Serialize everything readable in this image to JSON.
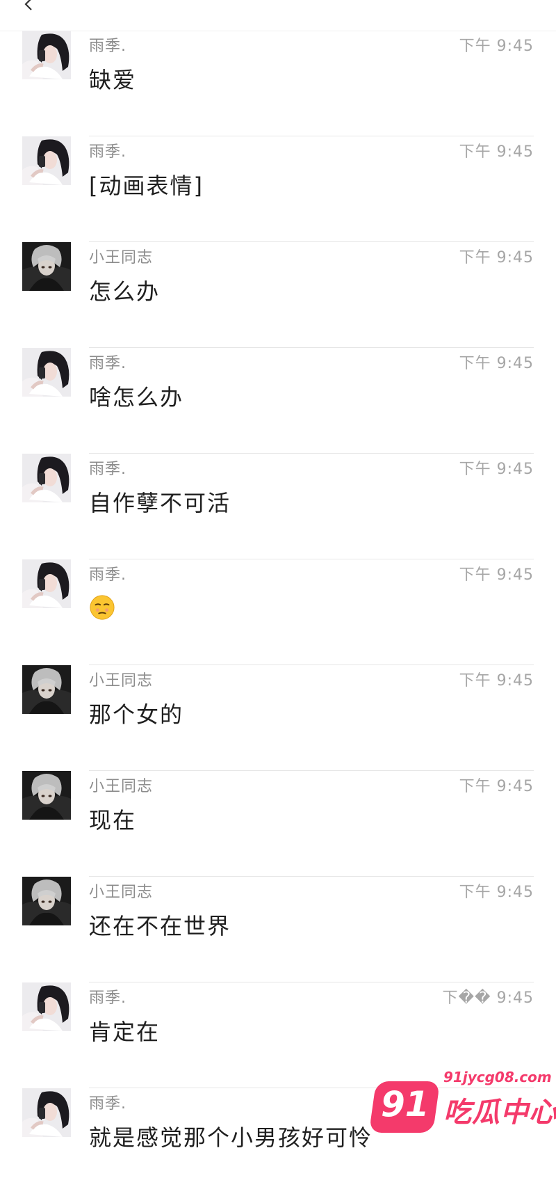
{
  "header": {
    "back_icon": "chevron-left-icon"
  },
  "messages": [
    {
      "sender": "雨季.",
      "time": "下午 9:45",
      "text": "缺爱",
      "avatar": "girl"
    },
    {
      "sender": "雨季.",
      "time": "下午 9:45",
      "text": "[动画表情]",
      "avatar": "girl"
    },
    {
      "sender": "小王同志",
      "time": "下午 9:45",
      "text": "怎么办",
      "avatar": "boy"
    },
    {
      "sender": "雨季.",
      "time": "下午 9:45",
      "text": "啥怎么办",
      "avatar": "girl"
    },
    {
      "sender": "雨季.",
      "time": "下午 9:45",
      "text": "自作孽不可活",
      "avatar": "girl"
    },
    {
      "sender": "雨季.",
      "time": "下午 9:45",
      "text": "",
      "emoji": "unamused-face-icon",
      "avatar": "girl"
    },
    {
      "sender": "小王同志",
      "time": "下午 9:45",
      "text": "那个女的",
      "avatar": "boy"
    },
    {
      "sender": "小王同志",
      "time": "下午 9:45",
      "text": "现在",
      "avatar": "boy"
    },
    {
      "sender": "小王同志",
      "time": "下午 9:45",
      "text": "还在不在世界",
      "avatar": "boy"
    },
    {
      "sender": "雨季.",
      "time": "下�� 9:45",
      "text": "肯定在",
      "avatar": "girl"
    },
    {
      "sender": "雨季.",
      "time": "",
      "text": "就是感觉那个小男孩好可怜",
      "avatar": "girl"
    }
  ],
  "watermark": {
    "badge": "91",
    "url": "91jycg08.com",
    "title": "吃瓜中心",
    "color": "#f43a6b"
  }
}
